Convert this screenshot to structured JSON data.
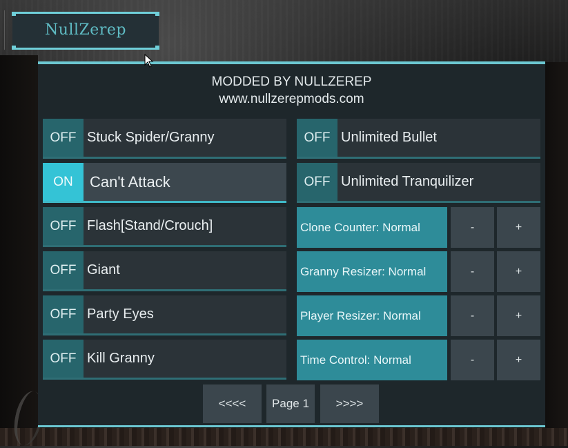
{
  "logo": {
    "text": "NullZerep"
  },
  "header": {
    "line1": "MODDED BY NULLZEREP",
    "line2": "www.nullzerepmods.com"
  },
  "left_toggles": [
    {
      "state": "OFF",
      "label": "Stuck Spider/Granny",
      "on": false
    },
    {
      "state": "ON",
      "label": "Can't Attack",
      "on": true
    },
    {
      "state": "OFF",
      "label": "Flash[Stand/Crouch]",
      "on": false
    },
    {
      "state": "OFF",
      "label": "Giant",
      "on": false
    },
    {
      "state": "OFF",
      "label": "Party Eyes",
      "on": false
    },
    {
      "state": "OFF",
      "label": "Kill Granny",
      "on": false
    }
  ],
  "right_toggles": [
    {
      "state": "OFF",
      "label": "Unlimited Bullet",
      "on": false
    },
    {
      "state": "OFF",
      "label": "Unlimited Tranquilizer",
      "on": false
    }
  ],
  "steppers": [
    {
      "label": "Clone Counter: Normal",
      "minus": "-",
      "plus": "+"
    },
    {
      "label": "Granny Resizer: Normal",
      "minus": "-",
      "plus": "+"
    },
    {
      "label": "Player Resizer: Normal",
      "minus": "-",
      "plus": "+"
    },
    {
      "label": "Time Control: Normal",
      "minus": "-",
      "plus": "+"
    }
  ],
  "pagination": {
    "prev": "<<<<",
    "page": "Page 1",
    "next": ">>>>"
  },
  "colors": {
    "accent": "#6cc8d2",
    "on_state": "#34c3d6",
    "off_state": "#27656c",
    "stepper_label": "#2e8c99"
  }
}
